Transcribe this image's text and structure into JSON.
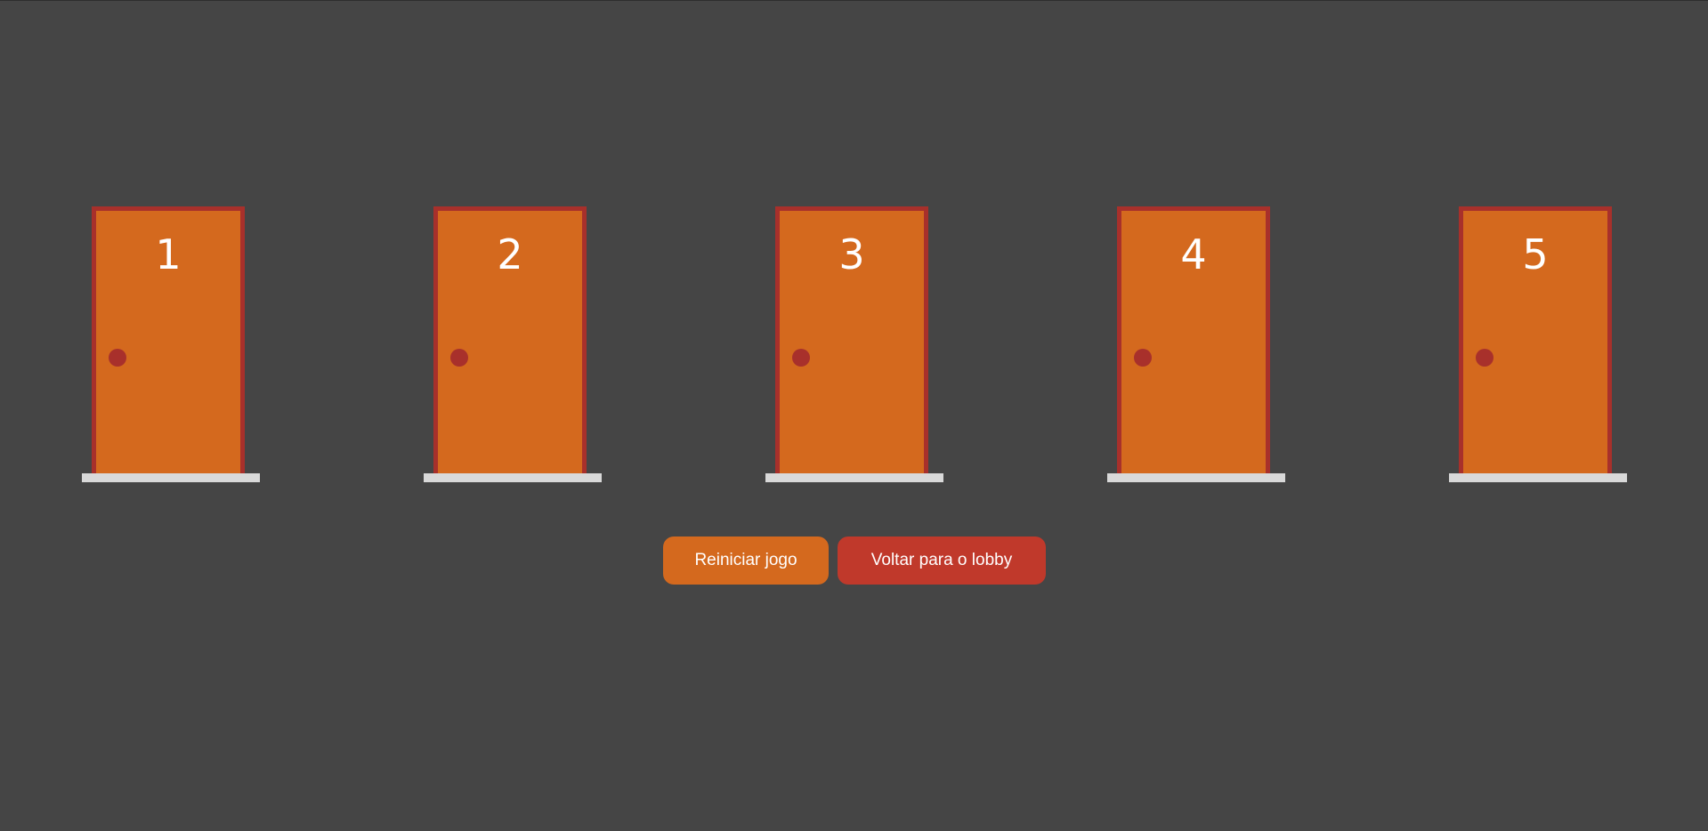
{
  "doors": [
    {
      "number": "1"
    },
    {
      "number": "2"
    },
    {
      "number": "3"
    },
    {
      "number": "4"
    },
    {
      "number": "5"
    }
  ],
  "actions": {
    "restart_label": "Reiniciar jogo",
    "lobby_label": "Voltar para o lobby"
  },
  "colors": {
    "background": "#454545",
    "door_fill": "#d4691e",
    "door_frame": "#a8302b",
    "threshold": "#d9d9d9",
    "restart_button": "#d4691e",
    "lobby_button": "#c0392b"
  }
}
